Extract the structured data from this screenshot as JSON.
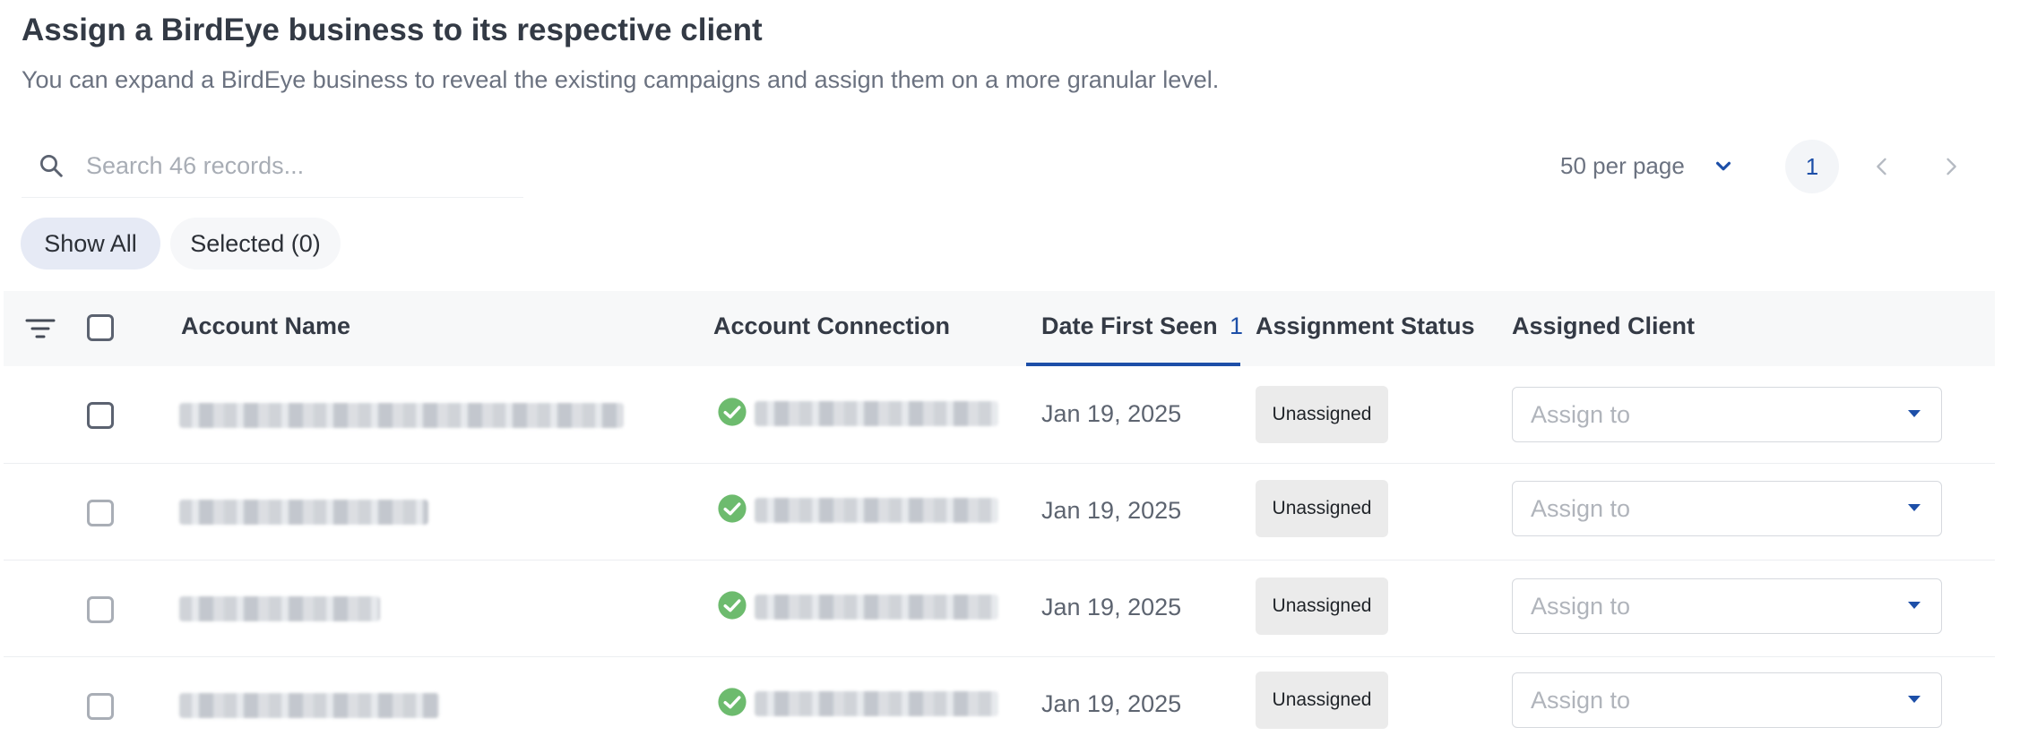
{
  "header": {
    "title": "Assign a BirdEye business to its respective client",
    "subtitle": "You can expand a BirdEye business to reveal the existing campaigns and assign them on a more granular level."
  },
  "search": {
    "placeholder": "Search 46 records...",
    "value": ""
  },
  "pagination": {
    "per_page_label": "50 per page",
    "current_page": "1"
  },
  "filters": {
    "show_all_label": "Show All",
    "selected_label": "Selected (0)"
  },
  "table": {
    "columns": {
      "account_name": "Account Name",
      "account_connection": "Account Connection",
      "date_first_seen": "Date First Seen",
      "sort_indicator": "1",
      "assignment_status": "Assignment Status",
      "assigned_client": "Assigned Client"
    },
    "rows": [
      {
        "date": "Jan 19, 2025",
        "status": "Unassigned",
        "assign_placeholder": "Assign to"
      },
      {
        "date": "Jan 19, 2025",
        "status": "Unassigned",
        "assign_placeholder": "Assign to"
      },
      {
        "date": "Jan 19, 2025",
        "status": "Unassigned",
        "assign_placeholder": "Assign to"
      },
      {
        "date": "Jan 19, 2025",
        "status": "Unassigned",
        "assign_placeholder": "Assign to"
      }
    ]
  },
  "colors": {
    "accent": "#1d4fa8",
    "connected_green": "#6dbb6e",
    "badge_bg": "#ebebeb"
  },
  "icons": {
    "search": "search-icon",
    "filter": "filter-icon",
    "chevron": "chevron-down-icon",
    "prev": "chevron-left-icon",
    "next": "chevron-right-icon",
    "connected": "check-circle-icon",
    "caret": "caret-down-icon"
  }
}
